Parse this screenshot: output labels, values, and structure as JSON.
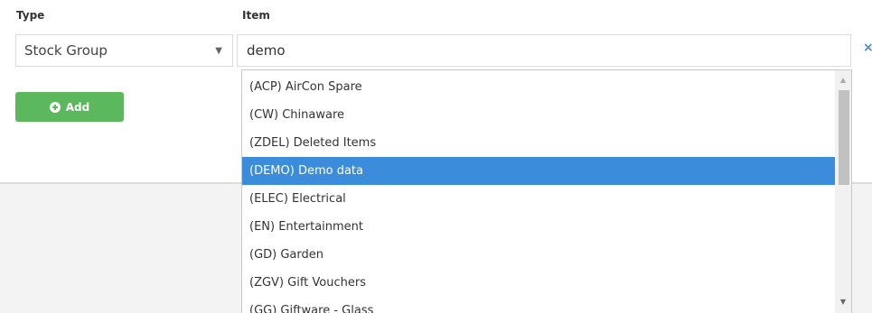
{
  "form": {
    "type_label": "Type",
    "item_label": "Item",
    "type_value": "Stock Group",
    "item_value": "demo",
    "add_label": "Add",
    "clear_glyph": "×"
  },
  "dropdown": {
    "selected_index": 3,
    "options": [
      "(ACP) AirCon Spare",
      "(CW) Chinaware",
      "(ZDEL) Deleted Items",
      "(DEMO) Demo data",
      "(ELEC) Electrical",
      "(EN) Entertainment",
      "(GD) Garden",
      "(ZGV) Gift Vouchers",
      "(GG) Giftware - Glass"
    ]
  },
  "colors": {
    "selected": "#3b8cda",
    "add_button": "#5cb85c",
    "clear_icon": "#3a8fd6"
  },
  "icons": {
    "caret": "caret-down-icon",
    "add": "plus-circle-icon",
    "clear": "close-icon"
  }
}
